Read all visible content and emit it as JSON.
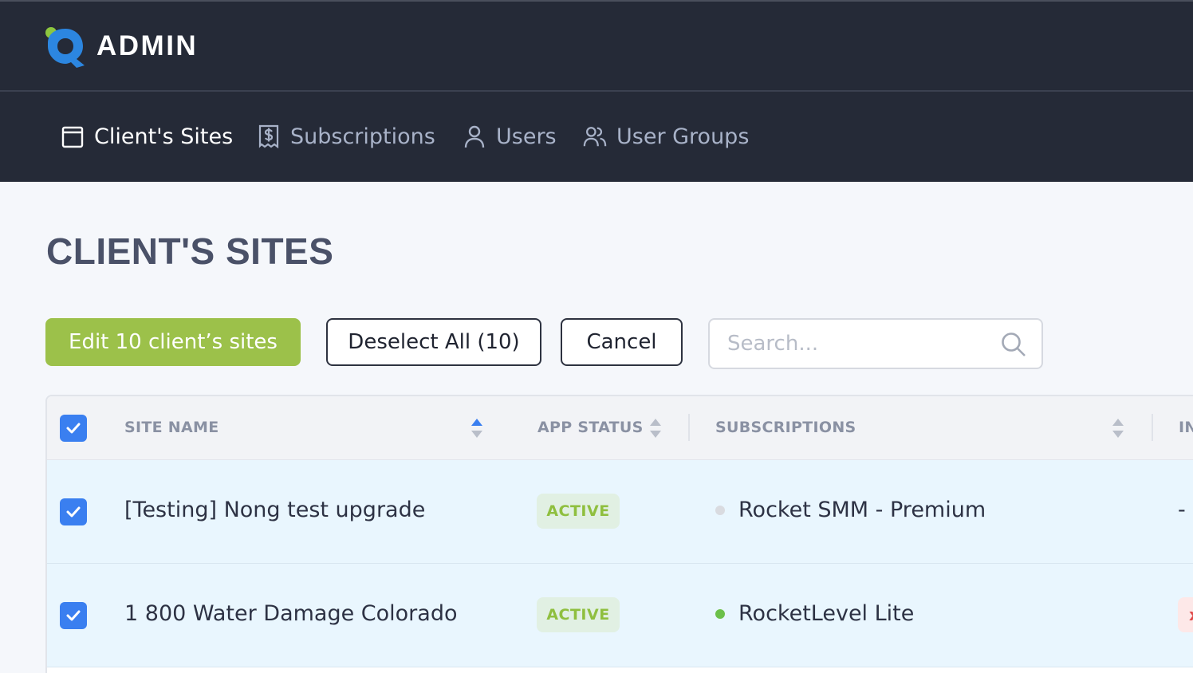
{
  "app": {
    "brand": "ADMIN"
  },
  "nav": {
    "items": [
      {
        "label": "Client's Sites",
        "icon": "calendar-icon",
        "active": true
      },
      {
        "label": "Subscriptions",
        "icon": "receipt-dollar-icon",
        "active": false
      },
      {
        "label": "Users",
        "icon": "user-icon",
        "active": false
      },
      {
        "label": "User Groups",
        "icon": "users-icon",
        "active": false
      }
    ]
  },
  "page": {
    "title": "CLIENT'S SITES"
  },
  "toolbar": {
    "edit_label": "Edit 10 client’s sites",
    "deselect_label": "Deselect All (10)",
    "cancel_label": "Cancel",
    "search_placeholder": "Search..."
  },
  "table": {
    "columns": [
      "SITE NAME",
      "APP STATUS",
      "SUBSCRIPTIONS",
      "IN"
    ],
    "rows": [
      {
        "selected": true,
        "site": "[Testing] Nong test upgrade",
        "status": "ACTIVE",
        "subscription": "Rocket SMM - Premium",
        "sub_dot_color": "#d9dbe0",
        "extra": "-"
      },
      {
        "selected": true,
        "site": "1 800 Water Damage Colorado",
        "status": "ACTIVE",
        "subscription": "RocketLevel Lite",
        "sub_dot_color": "#6cc04a",
        "extra": "x"
      }
    ]
  },
  "colors": {
    "accent": "#9cc14a",
    "header_bg": "#252a37",
    "checkbox": "#3a7ff0",
    "row_selected_bg": "#e9f6fe"
  }
}
